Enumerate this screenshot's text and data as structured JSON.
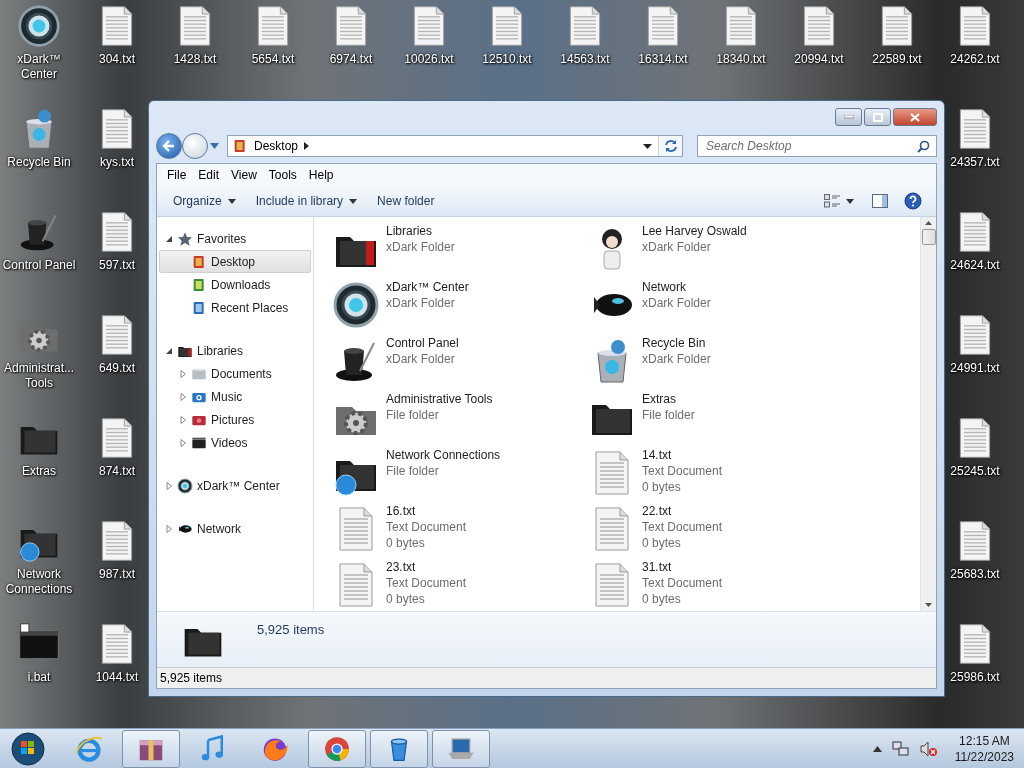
{
  "desktop": {
    "icon_columns": [
      [
        {
          "label": "xDark™ Center",
          "kind": "orb"
        },
        {
          "label": "Recycle Bin",
          "kind": "recycle"
        },
        {
          "label": "Control Panel",
          "kind": "hat"
        },
        {
          "label": "Administrat... Tools",
          "kind": "gears"
        },
        {
          "label": "Extras",
          "kind": "dark-folder"
        },
        {
          "label": "Network Connections",
          "kind": "globe-folder"
        },
        {
          "label": "i.bat",
          "kind": "terminal"
        }
      ],
      [
        {
          "label": "304.txt",
          "kind": "txt"
        },
        {
          "label": "kys.txt",
          "kind": "txt"
        },
        {
          "label": "597.txt",
          "kind": "txt"
        },
        {
          "label": "649.txt",
          "kind": "txt"
        },
        {
          "label": "874.txt",
          "kind": "txt"
        },
        {
          "label": "987.txt",
          "kind": "txt"
        },
        {
          "label": "1044.txt",
          "kind": "txt"
        }
      ],
      [
        {
          "label": "1428.txt",
          "kind": "txt"
        }
      ],
      [
        {
          "label": "5654.txt",
          "kind": "txt"
        }
      ],
      [
        {
          "label": "6974.txt",
          "kind": "txt"
        }
      ],
      [
        {
          "label": "10026.txt",
          "kind": "txt"
        }
      ],
      [
        {
          "label": "12510.txt",
          "kind": "txt"
        }
      ],
      [
        {
          "label": "14563.txt",
          "kind": "txt"
        }
      ],
      [
        {
          "label": "16314.txt",
          "kind": "txt"
        }
      ],
      [
        {
          "label": "18340.txt",
          "kind": "txt"
        }
      ],
      [
        {
          "label": "20994.txt",
          "kind": "txt"
        }
      ],
      [
        {
          "label": "22589.txt",
          "kind": "txt"
        }
      ],
      [
        {
          "label": "24262.txt",
          "kind": "txt"
        },
        {
          "label": "24357.txt",
          "kind": "txt"
        },
        {
          "label": "24624.txt",
          "kind": "txt"
        },
        {
          "label": "24991.txt",
          "kind": "txt"
        },
        {
          "label": "25245.txt",
          "kind": "txt"
        },
        {
          "label": "25683.txt",
          "kind": "txt"
        },
        {
          "label": "25986.txt",
          "kind": "txt"
        }
      ]
    ]
  },
  "window": {
    "address_bar": {
      "location": "Desktop"
    },
    "search": {
      "placeholder": "Search Desktop"
    },
    "menu_bar": [
      "File",
      "Edit",
      "View",
      "Tools",
      "Help"
    ],
    "command_bar": [
      {
        "label": "Organize",
        "dropdown": true
      },
      {
        "label": "Include in library",
        "dropdown": true
      },
      {
        "label": "New folder",
        "dropdown": false
      }
    ],
    "navigation_pane": {
      "items": [
        {
          "label": "Favorites",
          "kind": "star",
          "expanded": true,
          "selected": false,
          "children": [
            {
              "label": "Desktop",
              "kind": "desktop",
              "selected": true
            },
            {
              "label": "Downloads",
              "kind": "downloads",
              "selected": false
            },
            {
              "label": "Recent Places",
              "kind": "recent",
              "selected": false
            }
          ]
        },
        {
          "label": "Libraries",
          "kind": "red-folder",
          "expanded": true,
          "selected": false,
          "children": [
            {
              "label": "Documents",
              "kind": "documents",
              "expanded": false,
              "selected": false
            },
            {
              "label": "Music",
              "kind": "music",
              "expanded": false,
              "selected": false
            },
            {
              "label": "Pictures",
              "kind": "pictures",
              "expanded": false,
              "selected": false
            },
            {
              "label": "Videos",
              "kind": "videos",
              "expanded": false,
              "selected": false
            }
          ]
        },
        {
          "label": "xDark™ Center",
          "kind": "orb",
          "expanded": false,
          "selected": false
        },
        {
          "label": "Network",
          "kind": "blimp",
          "expanded": false,
          "selected": false
        }
      ]
    },
    "items": [
      {
        "name": "Libraries",
        "type": "xDark Folder",
        "kind": "red-folder"
      },
      {
        "name": "Lee Harvey Oswald",
        "type": "xDark Folder",
        "kind": "person"
      },
      {
        "name": "xDark™ Center",
        "type": "xDark Folder",
        "kind": "orb"
      },
      {
        "name": "Network",
        "type": "xDark Folder",
        "kind": "blimp"
      },
      {
        "name": "Control Panel",
        "type": "xDark Folder",
        "kind": "hat"
      },
      {
        "name": "Recycle Bin",
        "type": "xDark Folder",
        "kind": "recycle"
      },
      {
        "name": "Administrative Tools",
        "type": "File folder",
        "kind": "gears"
      },
      {
        "name": "Extras",
        "type": "File folder",
        "kind": "dark-folder"
      },
      {
        "name": "Network Connections",
        "type": "File folder",
        "kind": "globe-folder"
      },
      {
        "name": "14.txt",
        "type": "Text Document",
        "size": "0 bytes",
        "kind": "txt"
      },
      {
        "name": "16.txt",
        "type": "Text Document",
        "size": "0 bytes",
        "kind": "txt"
      },
      {
        "name": "22.txt",
        "type": "Text Document",
        "size": "0 bytes",
        "kind": "txt"
      },
      {
        "name": "23.txt",
        "type": "Text Document",
        "size": "0 bytes",
        "kind": "txt"
      },
      {
        "name": "31.txt",
        "type": "Text Document",
        "size": "0 bytes",
        "kind": "txt"
      }
    ],
    "details_pane": {
      "kind": "dark-folder",
      "item_count": "5,925 items"
    },
    "status_bar": "5,925 items"
  },
  "taskbar": {
    "items": [
      {
        "kind": "e",
        "running": false
      },
      {
        "kind": "archive",
        "running": true
      },
      {
        "kind": "note",
        "running": false
      },
      {
        "kind": "fox",
        "running": false
      },
      {
        "kind": "chrome",
        "running": true
      },
      {
        "kind": "bin",
        "running": true
      },
      {
        "kind": "laptop",
        "running": true
      }
    ],
    "time": "12:15 AM",
    "date": "11/22/2023"
  }
}
